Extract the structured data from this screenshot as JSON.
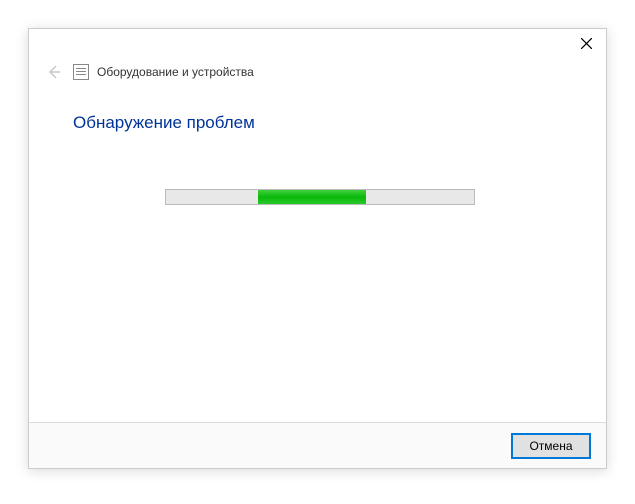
{
  "wizard": {
    "title": "Оборудование и устройства"
  },
  "content": {
    "heading": "Обнаружение проблем"
  },
  "progress": {
    "chunk_left_pct": 30,
    "chunk_width_pct": 35
  },
  "footer": {
    "cancel_label": "Отмена"
  }
}
